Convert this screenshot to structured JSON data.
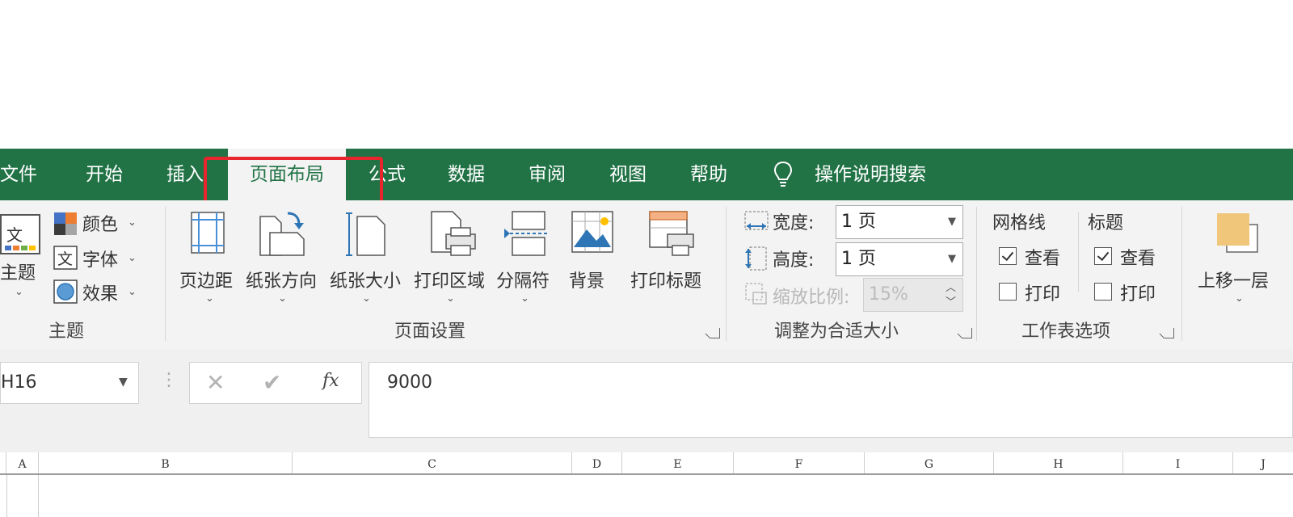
{
  "tabs": [
    "文件",
    "开始",
    "插入",
    "页面布局",
    "公式",
    "数据",
    "审阅",
    "视图",
    "帮助"
  ],
  "tell_me": "操作说明搜索",
  "theme_group": {
    "themes_label": "主题",
    "colors_label": "颜色",
    "fonts_label": "字体",
    "effects_label": "效果",
    "group_label": "主题"
  },
  "page_setup": {
    "margins": "页边距",
    "orientation": "纸张方向",
    "size": "纸张大小",
    "print_area": "打印区域",
    "breaks": "分隔符",
    "background": "背景",
    "print_titles": "打印标题",
    "group_label": "页面设置"
  },
  "scale_fit": {
    "width_label": "宽度:",
    "width_value": "1 页",
    "height_label": "高度:",
    "height_value": "1 页",
    "scale_label": "缩放比例:",
    "scale_value": "15%",
    "group_label": "调整为合适大小"
  },
  "sheet_options": {
    "gridlines_label": "网格线",
    "headings_label": "标题",
    "view_label": "查看",
    "print_label": "打印",
    "gridlines_view": true,
    "gridlines_print": false,
    "headings_view": true,
    "headings_print": false,
    "group_label": "工作表选项"
  },
  "arrange": {
    "bring_forward": "上移一层"
  },
  "formula_bar": {
    "name_box": "H16",
    "fx": "fx",
    "formula": "9000"
  },
  "columns": [
    "A",
    "B",
    "C",
    "D",
    "E",
    "F",
    "G",
    "H",
    "I",
    "J"
  ],
  "colors": {
    "accent": "#217346",
    "highlight": "#e8242c"
  }
}
